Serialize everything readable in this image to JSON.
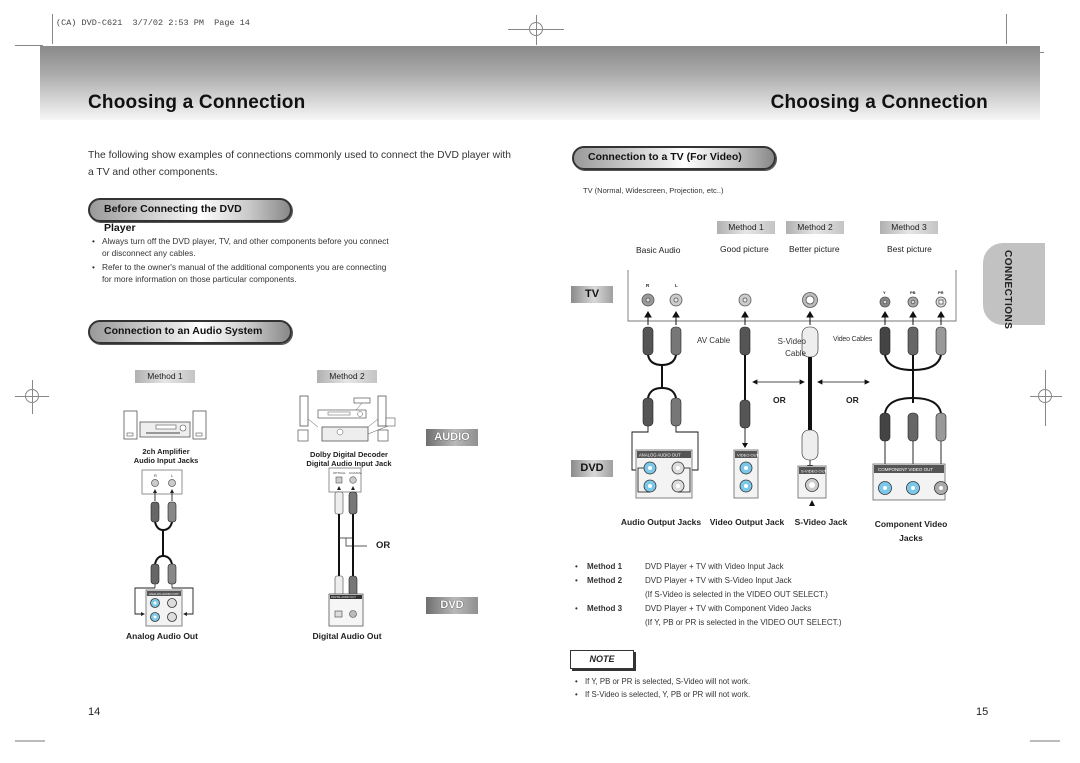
{
  "print_slug": "(CA) DVD-C621  3/7/02 2:53 PM  Page 14",
  "left_page": {
    "title": "Choosing a Connection",
    "intro": "The following show examples of connections commonly used to connect the DVD player with a TV and other components.",
    "before_connecting": {
      "heading": "Before Connecting the DVD Player",
      "bullets": [
        "Always turn off the DVD player, TV, and other components before you connect or disconnect any cables.",
        "Refer to the owner's manual of the additional components you are connecting for more information on those particular components."
      ]
    },
    "audio_system": {
      "heading": "Connection to an Audio System",
      "method1": {
        "label": "Method 1",
        "device": "2ch Amplifier",
        "input": "Audio Input Jacks",
        "jack_labels": [
          "R",
          "L"
        ],
        "output": "Analog Audio Out",
        "panel_label": "ANALOG AUDIO OUT"
      },
      "method2": {
        "label": "Method 2",
        "device": "Dolby Digital Decoder",
        "input": "Digital Audio Input Jack",
        "jack_labels": [
          "OPTICAL",
          "COAXIAL"
        ],
        "or_label": "OR",
        "output": "Digital Audio Out",
        "panel_label": "DIGITAL AUDIO OUT"
      },
      "audio_tag": "AUDIO",
      "dvd_tag": "DVD"
    },
    "page_number": "14"
  },
  "right_page": {
    "title": "Choosing a Connection",
    "tv_video": {
      "heading": "Connection to a TV (For Video)",
      "tv_types": "TV (Normal, Widescreen, Projection, etc..)",
      "methods": [
        {
          "label": "Method 1",
          "quality": "Good picture"
        },
        {
          "label": "Method 2",
          "quality": "Better picture"
        },
        {
          "label": "Method 3",
          "quality": "Best picture"
        }
      ],
      "basic_audio": "Basic Audio",
      "tv_tag": "TV",
      "dvd_tag": "DVD",
      "tv_jack_labels": {
        "audio": [
          "R",
          "L"
        ],
        "component": [
          "Y",
          "PB",
          "PR"
        ]
      },
      "cable_labels": {
        "av": "AV Cable",
        "svideo": "S-Video Cable",
        "video": "Video Cables"
      },
      "or_labels": [
        "OR",
        "OR"
      ],
      "dvd_panels": {
        "audio": "ANALOG AUDIO OUT",
        "video": "VIDEO OUT",
        "svideo": "S-VIDEO OUT",
        "component": "COMPONENT VIDEO OUT"
      },
      "jack_captions": [
        "Audio Output Jacks",
        "Video Output Jack",
        "S-Video Jack",
        "Component Video Jacks"
      ],
      "method_notes": [
        {
          "key": "Method 1",
          "text": "DVD Player + TV with Video Input Jack",
          "sub": ""
        },
        {
          "key": "Method 2",
          "text": "DVD Player + TV with S-Video Input Jack",
          "sub": "(If S-Video is selected in the VIDEO OUT SELECT.)"
        },
        {
          "key": "Method 3",
          "text": "DVD Player + TV with Component Video Jacks",
          "sub": "(If Y, PB or PR is selected in the VIDEO OUT SELECT.)"
        }
      ]
    },
    "side_tab": "CONNECTIONS",
    "note": {
      "label": "NOTE",
      "items": [
        "If Y, PB or PR is selected, S-Video will not work.",
        "If S-Video is selected, Y, PB or PR will not work."
      ]
    },
    "page_number": "15"
  },
  "colors": {
    "jack_blue": "#7cc8e8",
    "header_dark": "#8a8a8a",
    "tab_grey": "#c2c2c2"
  }
}
